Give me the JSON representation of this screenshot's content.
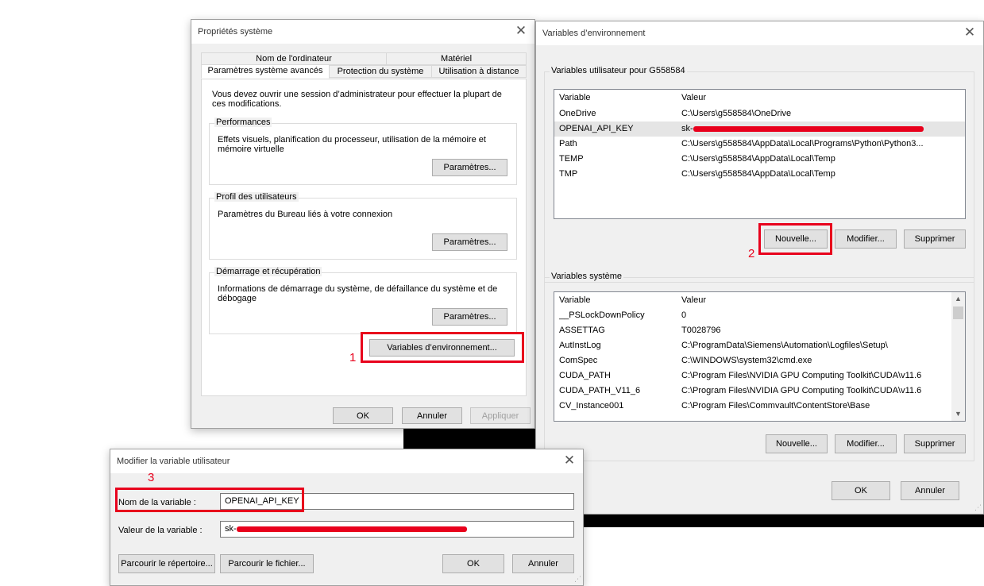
{
  "system_props": {
    "title": "Propriétés système",
    "tabs_top": [
      "Nom de l'ordinateur",
      "Matériel"
    ],
    "tabs_bottom": [
      "Paramètres système avancés",
      "Protection du système",
      "Utilisation à distance"
    ],
    "admin_note": "Vous devez ouvrir une session d’administrateur pour effectuer la plupart de ces modifications.",
    "performance": {
      "legend": "Performances",
      "text": "Effets visuels, planification du processeur, utilisation de la mémoire et mémoire virtuelle",
      "button": "Paramètres..."
    },
    "profile": {
      "legend": "Profil des utilisateurs",
      "text": "Paramètres du Bureau liés à votre connexion",
      "button": "Paramètres..."
    },
    "startup": {
      "legend": "Démarrage et récupération",
      "text": "Informations de démarrage du système, de défaillance du système et de débogage",
      "button": "Paramètres..."
    },
    "env_button": "Variables d’environnement...",
    "ok": "OK",
    "cancel": "Annuler",
    "apply": "Appliquer"
  },
  "env_vars": {
    "title": "Variables d’environnement",
    "user_section": "Variables utilisateur pour G558584",
    "col_variable": "Variable",
    "col_value": "Valeur",
    "user_rows": [
      {
        "name": "OneDrive",
        "value": "C:\\Users\\g558584\\OneDrive"
      },
      {
        "name": "OPENAI_API_KEY",
        "value": "sk-"
      },
      {
        "name": "Path",
        "value": "C:\\Users\\g558584\\AppData\\Local\\Programs\\Python\\Python3..."
      },
      {
        "name": "TEMP",
        "value": "C:\\Users\\g558584\\AppData\\Local\\Temp"
      },
      {
        "name": "TMP",
        "value": "C:\\Users\\g558584\\AppData\\Local\\Temp"
      }
    ],
    "user_buttons": {
      "new": "Nouvelle...",
      "edit": "Modifier...",
      "delete": "Supprimer"
    },
    "system_section": "Variables système",
    "system_rows": [
      {
        "name": "__PSLockDownPolicy",
        "value": "0"
      },
      {
        "name": "ASSETTAG",
        "value": "T0028796"
      },
      {
        "name": "AutInstLog",
        "value": "C:\\ProgramData\\Siemens\\Automation\\Logfiles\\Setup\\"
      },
      {
        "name": "ComSpec",
        "value": "C:\\WINDOWS\\system32\\cmd.exe"
      },
      {
        "name": "CUDA_PATH",
        "value": "C:\\Program Files\\NVIDIA GPU Computing Toolkit\\CUDA\\v11.6"
      },
      {
        "name": "CUDA_PATH_V11_6",
        "value": "C:\\Program Files\\NVIDIA GPU Computing Toolkit\\CUDA\\v11.6"
      },
      {
        "name": "CV_Instance001",
        "value": "C:\\Program Files\\Commvault\\ContentStore\\Base"
      }
    ],
    "system_buttons": {
      "new": "Nouvelle...",
      "edit": "Modifier...",
      "delete": "Supprimer"
    },
    "ok": "OK",
    "cancel": "Annuler"
  },
  "edit_var": {
    "title": "Modifier la variable utilisateur",
    "name_label": "Nom de la variable :",
    "name_value": "OPENAI_API_KEY",
    "value_label": "Valeur de la variable :",
    "value_prefix": "sk-",
    "browse_dir": "Parcourir le répertoire...",
    "browse_file": "Parcourir le fichier...",
    "ok": "OK",
    "cancel": "Annuler"
  },
  "annotations": [
    "1",
    "2",
    "3"
  ],
  "colors": {
    "highlight": "#e8001c",
    "dialog_bg": "#f0f0f0"
  }
}
